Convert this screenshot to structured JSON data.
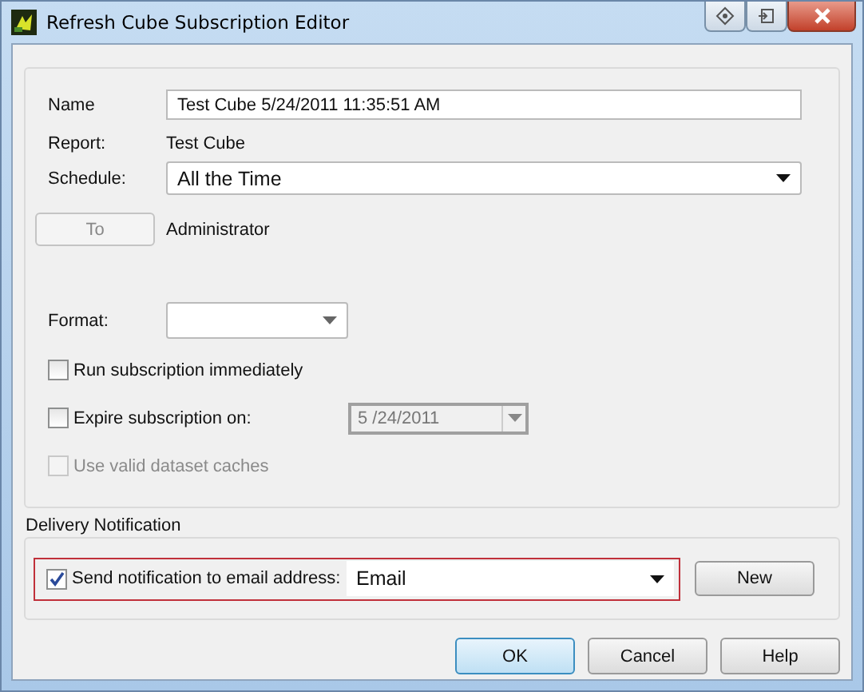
{
  "window": {
    "title": "Refresh Cube Subscription Editor"
  },
  "name": {
    "label": "Name",
    "value": "Test Cube 5/24/2011 11:35:51 AM"
  },
  "report": {
    "label": "Report:",
    "value": "Test Cube"
  },
  "schedule": {
    "label": "Schedule:",
    "value": "All the Time"
  },
  "recipient": {
    "button": {
      "label": "To",
      "disabled": true
    },
    "value": "Administrator"
  },
  "format": {
    "label": "Format:"
  },
  "options": [
    {
      "kind": "plain",
      "label": "Run subscription immediately",
      "checked": false,
      "disabled": false
    },
    {
      "kind": "date",
      "label": "Expire subscription on:",
      "checked": false,
      "disabled": false,
      "date": {
        "value": "5 /24/2011",
        "disabled": true
      }
    },
    {
      "kind": "plain",
      "label": "Use valid dataset caches",
      "checked": false,
      "disabled": true
    }
  ],
  "delivery": {
    "title": "Delivery Notification",
    "send": {
      "label": "Send notification to email address:",
      "checked": true
    },
    "email": {
      "value": "Email"
    },
    "new_button": "New"
  },
  "buttons": [
    {
      "label": "OK",
      "default": true
    },
    {
      "label": "Cancel",
      "default": false
    },
    {
      "label": "Help",
      "default": false
    }
  ]
}
